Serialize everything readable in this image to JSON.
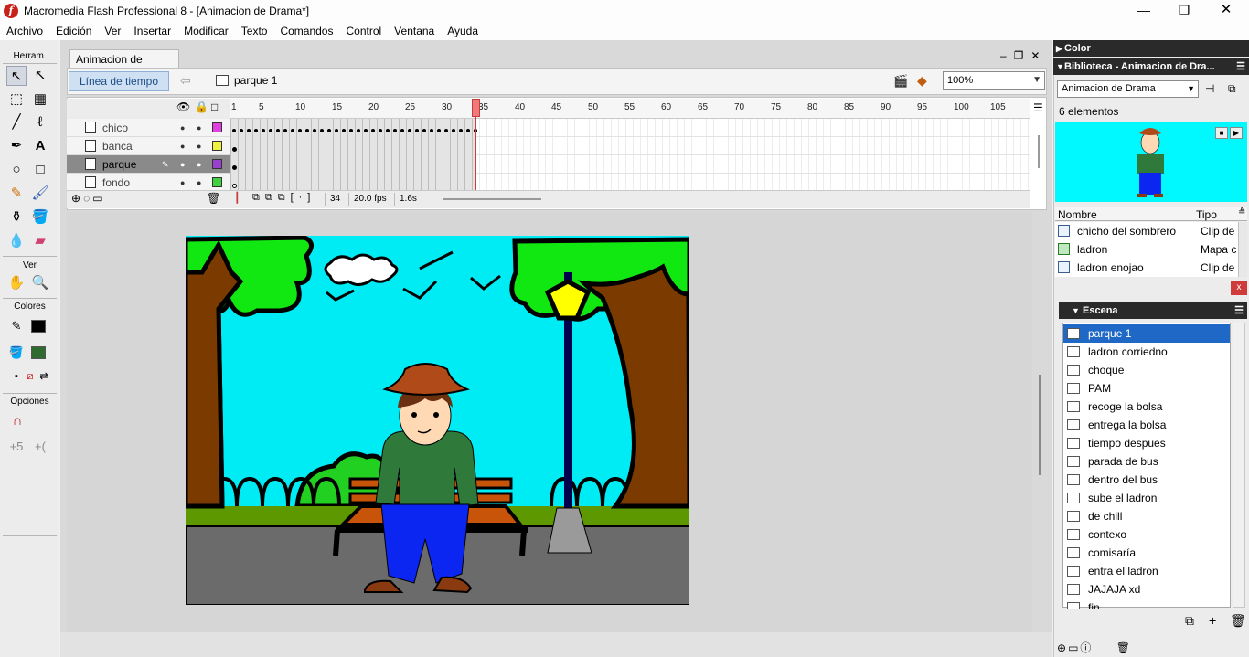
{
  "window": {
    "title": "Macromedia Flash Professional 8 - [Animacion de Drama*]",
    "minimize": "—",
    "maximize": "❐",
    "close": "✕"
  },
  "menu": [
    "Archivo",
    "Edición",
    "Ver",
    "Insertar",
    "Modificar",
    "Texto",
    "Comandos",
    "Control",
    "Ventana",
    "Ayuda"
  ],
  "tools": {
    "header": "Herram.",
    "view_label": "Ver",
    "colors_label": "Colores",
    "options_label": "Opciones",
    "stroke_color": "#000000",
    "fill_color": "#2f6b2f"
  },
  "document": {
    "tab": "Animacion de Drama*",
    "timeline_button": "Línea de tiempo",
    "scene_crumb": "parque 1",
    "zoom": "100%"
  },
  "timeline": {
    "ruler": [
      "1",
      "5",
      "10",
      "15",
      "20",
      "25",
      "30",
      "35",
      "40",
      "45",
      "50",
      "55",
      "60",
      "65",
      "70",
      "75",
      "80",
      "85",
      "90",
      "95",
      "100",
      "105"
    ],
    "layers": [
      {
        "name": "chico",
        "color": "#e040e0",
        "selected": false
      },
      {
        "name": "banca",
        "color": "#f0f040",
        "selected": false
      },
      {
        "name": "parque",
        "color": "#9a40d0",
        "selected": true
      },
      {
        "name": "fondo",
        "color": "#40d040",
        "selected": false
      }
    ],
    "current_frame": "34",
    "fps": "20.0 fps",
    "elapsed": "1.6s"
  },
  "panels": {
    "color_title": "Color",
    "library_title": "Biblioteca - Animacion de Dra...",
    "library_dropdown": "Animacion de Drama",
    "library_count": "6 elementos",
    "col_name": "Nombre",
    "col_type": "Tipo",
    "library_items": [
      {
        "name": "chicho del sombrero",
        "type": "Clip de"
      },
      {
        "name": "ladron",
        "type": "Mapa c"
      },
      {
        "name": "ladron enojao",
        "type": "Clip de"
      }
    ],
    "scene_title": "Escena",
    "scenes": [
      "parque 1",
      "ladron corriedno",
      "choque",
      "PAM",
      "recoge la bolsa",
      "entrega la bolsa",
      "tiempo despues",
      "parada de bus",
      "dentro del bus",
      "sube el ladron",
      "de chill",
      "contexo",
      "comisaría",
      "entra el ladron",
      "JAJAJA xd",
      "fin"
    ],
    "selected_scene": "parque 1"
  }
}
